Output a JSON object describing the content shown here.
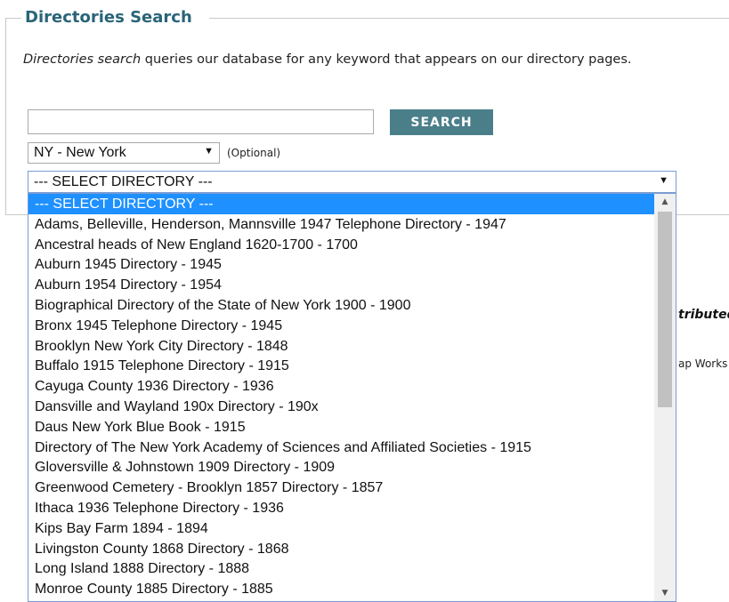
{
  "section": {
    "legend": "Directories Search",
    "description_em": "Directories search",
    "description_rest": " queries our database for any keyword that appears on our directory pages."
  },
  "search": {
    "input_value": "",
    "placeholder": "",
    "button_label": "SEARCH"
  },
  "state_select": {
    "value": "NY - New York",
    "optional_label": "(Optional)"
  },
  "directory_select": {
    "value": "--- SELECT DIRECTORY ---",
    "options": [
      "--- SELECT DIRECTORY ---",
      "Adams, Belleville, Henderson, Mannsville 1947 Telephone Directory - 1947",
      "Ancestral heads of New England 1620-1700 - 1700",
      "Auburn 1945 Directory - 1945",
      "Auburn 1954 Directory - 1954",
      "Biographical Directory of the State of New York 1900 - 1900",
      "Bronx 1945 Telephone Directory - 1945",
      "Brooklyn New York City Directory - 1848",
      "Buffalo 1915 Telephone Directory - 1915",
      "Cayuga County 1936 Directory - 1936",
      "Dansville and Wayland 190x Directory - 190x",
      "Daus New York Blue Book - 1915",
      "Directory of The New York Academy of Sciences and Affiliated Societies - 1915",
      "Gloversville & Johnstown 1909 Directory - 1909",
      "Greenwood Cemetery - Brooklyn 1857 Directory - 1857",
      "Ithaca 1936 Telephone Directory - 1936",
      "Kips Bay Farm 1894 - 1894",
      "Livingston County 1868 Directory - 1868",
      "Long Island 1888 Directory - 1888",
      "Monroe County 1885 Directory - 1885"
    ]
  },
  "side": {
    "text1": "tributed",
    "text2": "ap Works"
  },
  "icons": {
    "dropdown_arrow": "▼",
    "scroll_up": "▲",
    "scroll_down": "▼"
  },
  "colors": {
    "legend": "#2a6478",
    "button": "#4a7f8a",
    "selected_option": "#1e90ff"
  }
}
